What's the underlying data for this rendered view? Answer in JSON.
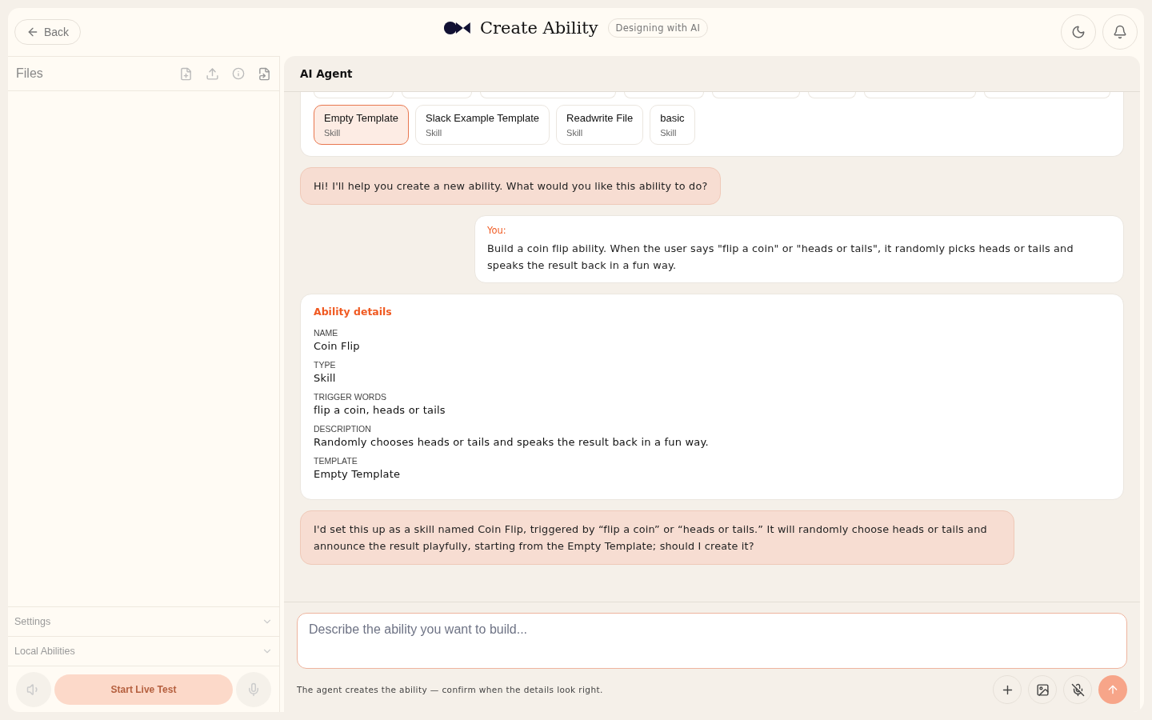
{
  "header": {
    "back": "Back",
    "title": "Create Ability",
    "badge": "Designing with AI"
  },
  "files": {
    "title": "Files"
  },
  "sidebar_sections": [
    {
      "label": "Settings",
      "disabled": true
    },
    {
      "label": "Local Abilities",
      "disabled": true
    }
  ],
  "live_test": {
    "label": "Start Live Test",
    "disabled": true
  },
  "agent": {
    "title": "AI Agent"
  },
  "templates": [
    {
      "name": "Empty Template",
      "type": "Skill",
      "selected": true
    },
    {
      "name": "Slack Example Template",
      "type": "Skill",
      "selected": false
    },
    {
      "name": "Readwrite File",
      "type": "Skill",
      "selected": false
    },
    {
      "name": "basic",
      "type": "Skill",
      "selected": false
    }
  ],
  "messages": [
    {
      "kind": "agent",
      "text": "Hi! I'll help you create a new ability. What would you like this ability to do?"
    },
    {
      "kind": "user",
      "sender": "You:",
      "text": "Build a coin flip ability. When the user says \"flip a coin\" or \"heads or tails\", it randomly picks heads or tails and speaks the result back in a fun way."
    },
    {
      "kind": "details",
      "title": "Ability details",
      "fields": [
        {
          "label": "NAME",
          "value": "Coin Flip"
        },
        {
          "label": "TYPE",
          "value": "Skill"
        },
        {
          "label": "TRIGGER WORDS",
          "value": "flip a coin, heads or tails"
        },
        {
          "label": "DESCRIPTION",
          "value": "Randomly chooses heads or tails and speaks the result back in a fun way."
        },
        {
          "label": "TEMPLATE",
          "value": "Empty Template"
        }
      ]
    },
    {
      "kind": "agent",
      "text": "I'd set this up as a skill named Coin Flip, triggered by “flip a coin” or “heads or tails.” It will randomly choose heads or tails and announce the result playfully, starting from the Empty Template; should I create it?"
    }
  ],
  "composer": {
    "placeholder": "Describe the ability you want to build...",
    "hint": "The agent creates the ability — confirm when the details look right."
  }
}
